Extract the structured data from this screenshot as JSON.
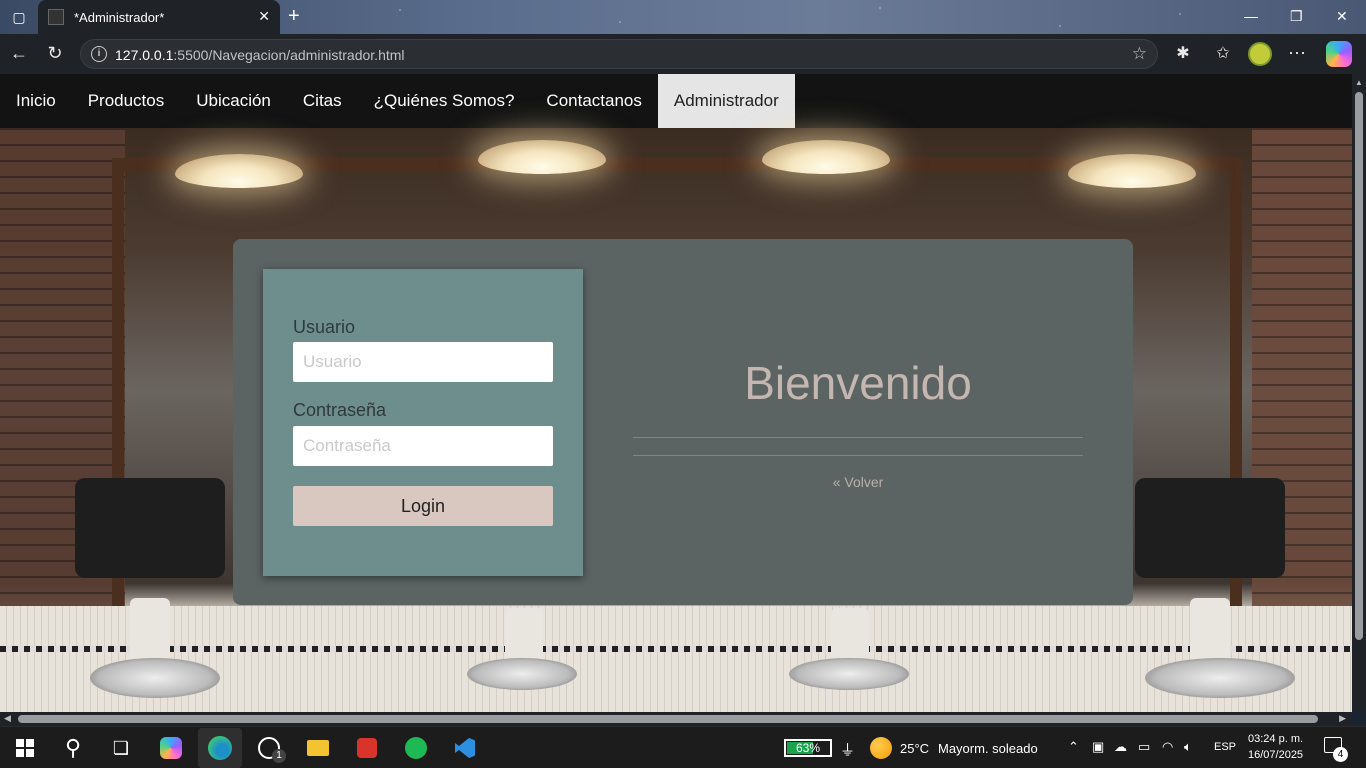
{
  "browser": {
    "tab_title": "*Administrador*",
    "url_host": "127.0.0.1",
    "url_rest": ":5500/Navegacion/administrador.html"
  },
  "site_nav": {
    "items": [
      {
        "label": "Inicio",
        "active": false
      },
      {
        "label": "Productos",
        "active": false
      },
      {
        "label": "Ubicación",
        "active": false
      },
      {
        "label": "Citas",
        "active": false
      },
      {
        "label": "¿Quiénes Somos?",
        "active": false
      },
      {
        "label": "Contactanos",
        "active": false
      },
      {
        "label": "Administrador",
        "active": true
      }
    ]
  },
  "login": {
    "user_label": "Usuario",
    "user_placeholder": "Usuario",
    "password_label": "Contraseña",
    "password_placeholder": "Contraseña",
    "button_label": "Login"
  },
  "welcome": {
    "heading": "Bienvenido",
    "back_link": "« Volver"
  },
  "taskbar": {
    "battery_percent": "63%",
    "battery_level": 0.63,
    "temperature": "25°C",
    "weather": "Mayorm. soleado",
    "language": "ESP",
    "time": "03:24 p. m.",
    "date": "16/07/2025",
    "whatsapp_badge": "1",
    "notification_count": "4"
  },
  "colors": {
    "card_bg": "#5b6463",
    "form_bg": "#6e8e8e",
    "button_bg": "#d9c8c0",
    "nav_bg": "#131313",
    "nav_active_bg": "#e5e5e5"
  }
}
